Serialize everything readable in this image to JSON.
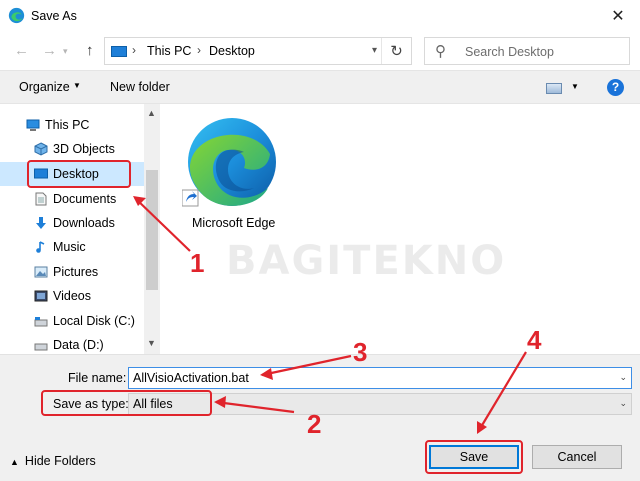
{
  "window": {
    "title": "Save As",
    "close_icon": "close-icon",
    "app_icon": "edge-icon"
  },
  "address": {
    "crumbs": [
      "This PC",
      "Desktop"
    ],
    "search_placeholder": "Search Desktop"
  },
  "toolbar": {
    "organize_label": "Organize",
    "new_folder_label": "New folder",
    "help_label": "?"
  },
  "nav": {
    "items": [
      {
        "label": "This PC",
        "icon": "computer-icon"
      },
      {
        "label": "3D Objects",
        "icon": "3d-objects-icon"
      },
      {
        "label": "Desktop",
        "icon": "desktop-icon",
        "selected": true
      },
      {
        "label": "Documents",
        "icon": "documents-icon"
      },
      {
        "label": "Downloads",
        "icon": "downloads-icon"
      },
      {
        "label": "Music",
        "icon": "music-icon"
      },
      {
        "label": "Pictures",
        "icon": "pictures-icon"
      },
      {
        "label": "Videos",
        "icon": "videos-icon"
      },
      {
        "label": "Local Disk (C:)",
        "icon": "local-disk-icon"
      },
      {
        "label": "Data (D:)",
        "icon": "drive-icon"
      }
    ]
  },
  "files": [
    {
      "label": "Microsoft Edge",
      "icon": "edge-shortcut-icon"
    }
  ],
  "watermark": "BAGITEKNO",
  "form": {
    "file_name_label": "File name:",
    "file_name_value": "AllVisioActivation.bat",
    "save_type_label": "Save as type:",
    "save_type_value": "All files"
  },
  "footer": {
    "hide_folders_label": "Hide Folders",
    "save_label": "Save",
    "cancel_label": "Cancel"
  },
  "annotations": {
    "markers": [
      "1",
      "2",
      "3",
      "4"
    ],
    "color": "#e0242c"
  },
  "colors": {
    "accent": "#0078d7",
    "selection": "#cce8ff"
  }
}
